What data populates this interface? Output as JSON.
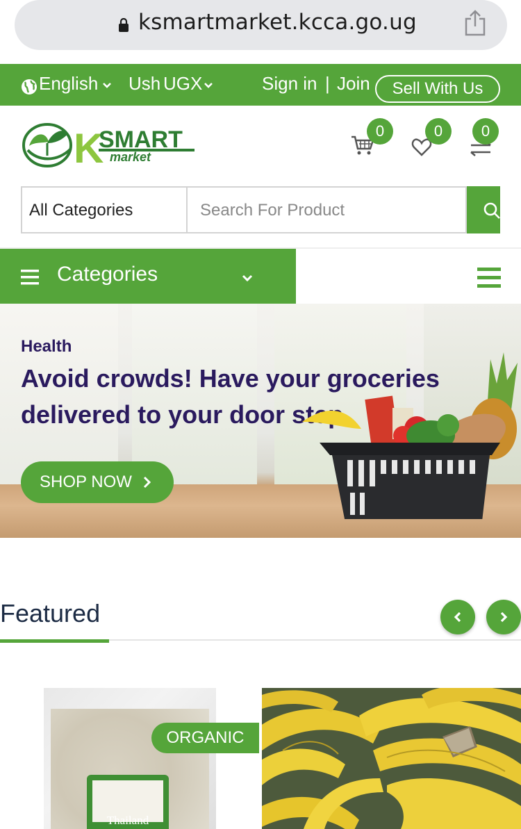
{
  "browser": {
    "url": "ksmartmarket.kcca.go.ug"
  },
  "topbar": {
    "language": "English",
    "currency_prefix": "Ush",
    "currency": "UGX",
    "signin": "Sign in",
    "separator": "|",
    "join": "Join",
    "sell": "Sell With Us"
  },
  "header": {
    "logo_text_main": "SMART",
    "logo_text_letter": "K",
    "logo_text_sub": "market",
    "cart_count": "0",
    "wishlist_count": "0",
    "compare_count": "0"
  },
  "search": {
    "category": "All Categories",
    "placeholder": "Search For Product"
  },
  "nav": {
    "categories_label": "Categories"
  },
  "hero": {
    "subtitle": "Health",
    "title": "Avoid crowds! Have your groceries delivered to your door step",
    "button": "SHOP NOW"
  },
  "featured": {
    "title": "Featured",
    "products": [
      {
        "badge": "ORGANIC",
        "package_text": "Thailand"
      },
      {
        "badge": ""
      }
    ]
  },
  "colors": {
    "brand_green": "#55a53a",
    "hero_text": "#2a1a5e",
    "featured_title": "#1c2b44"
  }
}
